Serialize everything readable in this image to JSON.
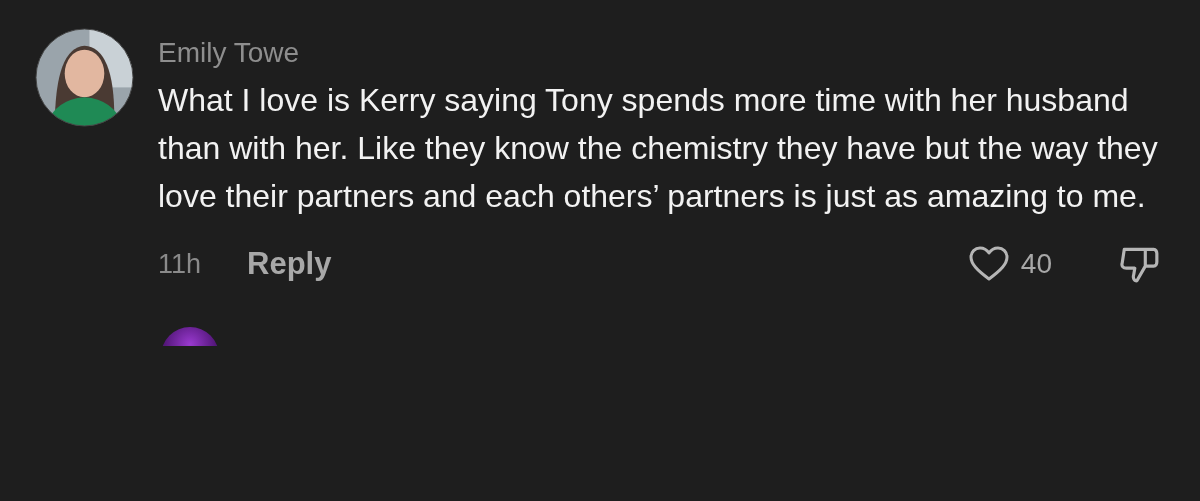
{
  "comment": {
    "author": "Emily Towe",
    "text": "What I love is Kerry saying Tony spends more time with her husband than with her. Like they know the chemistry they have but the way they love their partners and each others’ partners is just as amazing to me.",
    "time": "11h",
    "reply_label": "Reply",
    "likes": "40",
    "liked": false
  }
}
